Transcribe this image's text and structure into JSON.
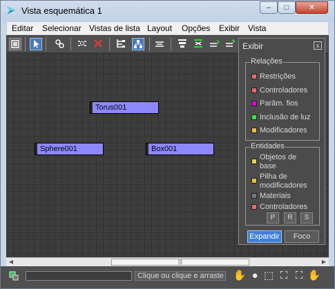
{
  "window": {
    "title": "Vista esquemática 1",
    "minimize": "–",
    "maximize": "□",
    "close": "✕"
  },
  "menu": [
    "Editar",
    "Selecionar",
    "Vistas de lista",
    "Layout",
    "Opções",
    "Exibir",
    "Vista"
  ],
  "toolbar": [
    "display-floater",
    "select",
    "connect",
    "unlink-selected",
    "delete",
    "hierarchy-mode",
    "references-mode",
    "move-children",
    "align-left",
    "align-center",
    "align-right",
    "arrange"
  ],
  "nodes": {
    "torus": "Torus001",
    "sphere": "Sphere001",
    "box": "Box001"
  },
  "display_panel": {
    "title": "Exibir",
    "close": "x",
    "relations": {
      "label": "Relações",
      "items": [
        {
          "label": "Restrições",
          "color": "#e86a6a"
        },
        {
          "label": "Controladores",
          "color": "#e86a6a"
        },
        {
          "label": "Parâm. fios",
          "color": "#e000e0"
        },
        {
          "label": "Inclusão de luz",
          "color": "#40e040"
        },
        {
          "label": "Modificadores",
          "color": "#e8c03a"
        }
      ]
    },
    "entities": {
      "label": "Entidades",
      "items": [
        {
          "label_line1": "Objetos de",
          "label_line2": "base",
          "color": "#e8d35a"
        },
        {
          "label_line1": "Pilha de",
          "label_line2": "modificadores",
          "color": "#e8c03a"
        },
        {
          "label_line1": "Materiais",
          "label_line2": "",
          "color": "#7a7a7a"
        },
        {
          "label_line1": "Controladores",
          "label_line2": "",
          "color": "#e86a6a"
        }
      ],
      "buttons": [
        "P",
        "R",
        "S"
      ]
    },
    "expand": "Expandir",
    "focus": "Foco"
  },
  "status": {
    "prompt": "Clique ou clique e arraste p",
    "icons": [
      "pan-icon",
      "zoom-icon",
      "zoom-region-icon",
      "zoom-extents-icon",
      "zoom-selected-icon",
      "pan-hand-icon"
    ]
  },
  "colors": {
    "node_fill": "#8e88ff",
    "active_button": "#4a78b8",
    "canvas": "#3d3d3d"
  }
}
